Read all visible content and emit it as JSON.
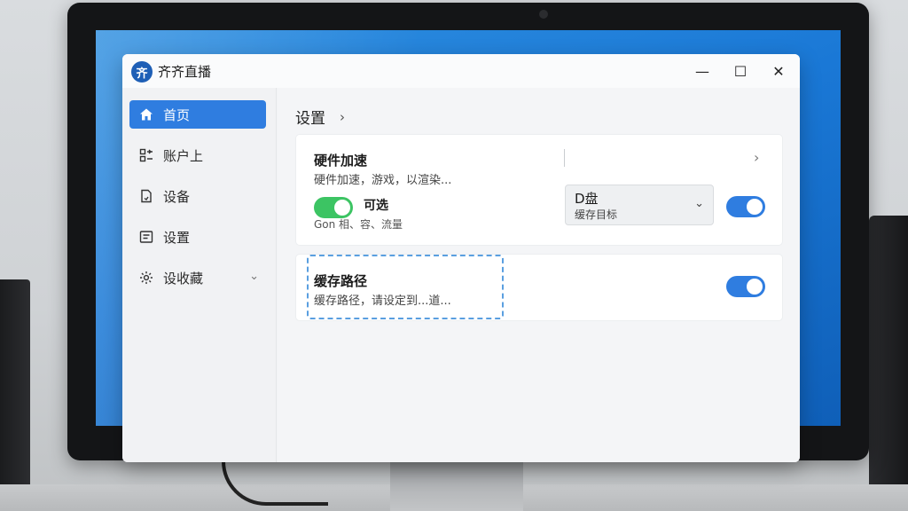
{
  "app": {
    "title": "齐齐直播",
    "logo_glyph": "齐",
    "window_controls": {
      "minimize": "—",
      "maximize": "☐",
      "close": "✕"
    }
  },
  "sidebar": {
    "items": [
      {
        "label": "首页",
        "icon": "home-icon",
        "active": true
      },
      {
        "label": "账户上",
        "icon": "list-icon",
        "active": false
      },
      {
        "label": "设备",
        "icon": "document-icon",
        "active": false
      },
      {
        "label": "设置",
        "icon": "form-icon",
        "active": false
      },
      {
        "label": "设收藏",
        "icon": "gear-icon",
        "active": false,
        "expandable": true
      }
    ]
  },
  "main": {
    "breadcrumb": "设置",
    "cards": {
      "hardware": {
        "title": "硬件加速",
        "description": "硬件加速，游戏，以渲染...",
        "toggle_label": "可选",
        "toggle_sub": "Gon  相、容、流量",
        "select": {
          "value": "D盘",
          "sub": "缓存目标"
        }
      },
      "cache": {
        "title": "缓存路径",
        "description": "缓存路径，请设定到...道..."
      }
    }
  },
  "colors": {
    "accent": "#2f7de0",
    "toggle_green": "#3cc463",
    "desktop_blue": "#1a78d6"
  }
}
